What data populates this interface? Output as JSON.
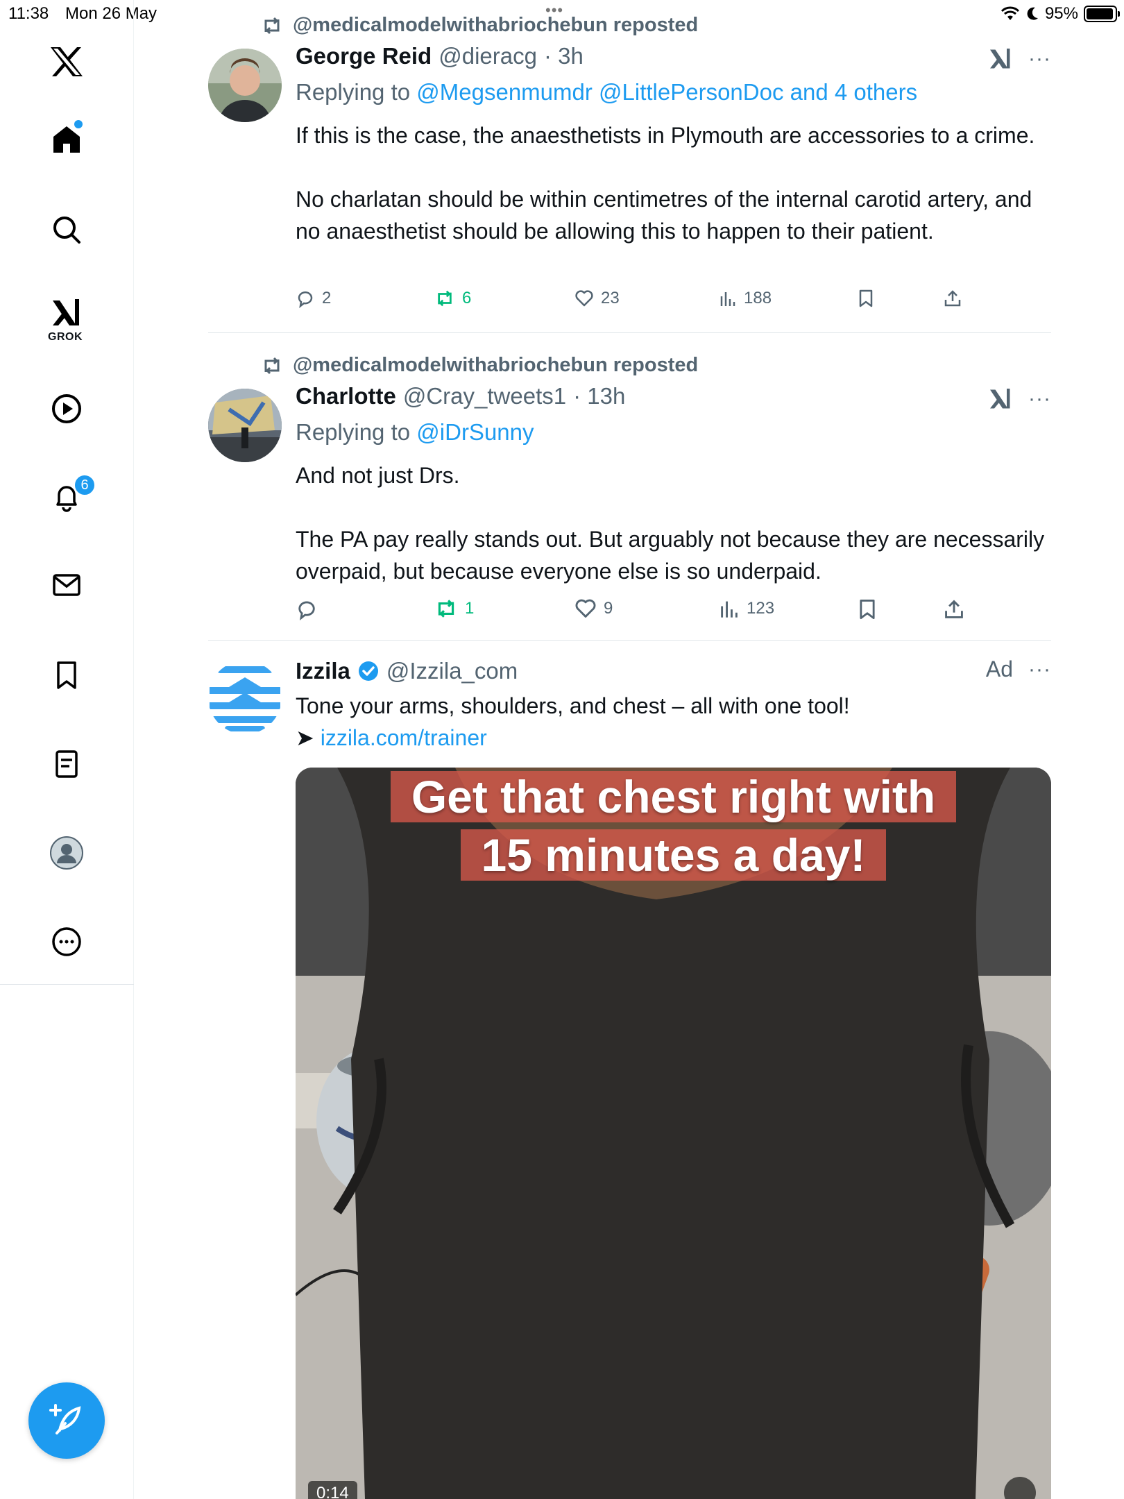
{
  "status_bar": {
    "time": "11:38",
    "date": "Mon 26 May",
    "battery": "95%",
    "battery_level": 0.95
  },
  "sidebar": {
    "grok_label": "GROK",
    "notifications_count": "6"
  },
  "posts": [
    {
      "repost_text": "@medicalmodelwithabriochebun reposted",
      "name": "George Reid",
      "handle": "@dieracg",
      "time": "· 3h",
      "replying_prefix": "Replying to",
      "replying_to": "@Megsenmumdr @LittlePersonDoc and 4 others",
      "paragraphs": [
        "If this is the case, the anaesthetists in Plymouth are accessories to a crime.",
        "No charlatan should be within centimetres of the internal carotid artery, and no anaesthetist should be allowing this to happen to their patient."
      ],
      "replies": "2",
      "reposts": "6",
      "likes": "23",
      "views": "188"
    },
    {
      "repost_text": "@medicalmodelwithabriochebun reposted",
      "name": "Charlotte",
      "handle": "@Cray_tweets1",
      "time": "· 13h",
      "replying_prefix": "Replying to",
      "replying_to": "@iDrSunny",
      "paragraphs": [
        "And not just Drs.",
        "The PA pay really stands out. But arguably not because they are necessarily overpaid, but because everyone else is so underpaid."
      ],
      "replies": "",
      "reposts": "1",
      "likes": "9",
      "views": "123"
    }
  ],
  "ad": {
    "name": "Izzila",
    "handle": "@Izzila_com",
    "ad_label": "Ad",
    "text": "Tone your arms, shoulders, and chest – all with one tool!",
    "link_arrow": "➤",
    "link": "izzila.com/trainer",
    "video_caption_line1": "Get that chest right with",
    "video_caption_line2": "15 minutes a day!",
    "video_time": "0:14"
  },
  "colors": {
    "accent": "#1d9bf0",
    "repost_green": "#00ba7c",
    "secondary_text": "#536471",
    "divider": "#e1e6ea"
  }
}
